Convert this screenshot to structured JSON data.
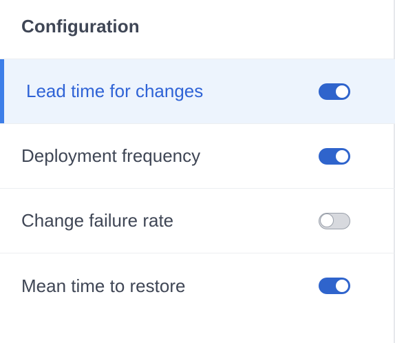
{
  "panel": {
    "title": "Configuration",
    "items": [
      {
        "label": "Lead time for changes",
        "enabled": true,
        "active": true
      },
      {
        "label": "Deployment frequency",
        "enabled": true,
        "active": false
      },
      {
        "label": "Change failure rate",
        "enabled": false,
        "active": false
      },
      {
        "label": "Mean time to restore",
        "enabled": true,
        "active": false
      }
    ]
  },
  "colors": {
    "accent": "#3d7ee8",
    "active_text": "#2f63d6",
    "active_bg": "#edf4fd",
    "toggle_on": "#2f64cc",
    "toggle_off": "#d7d9de",
    "text": "#3f4655"
  }
}
